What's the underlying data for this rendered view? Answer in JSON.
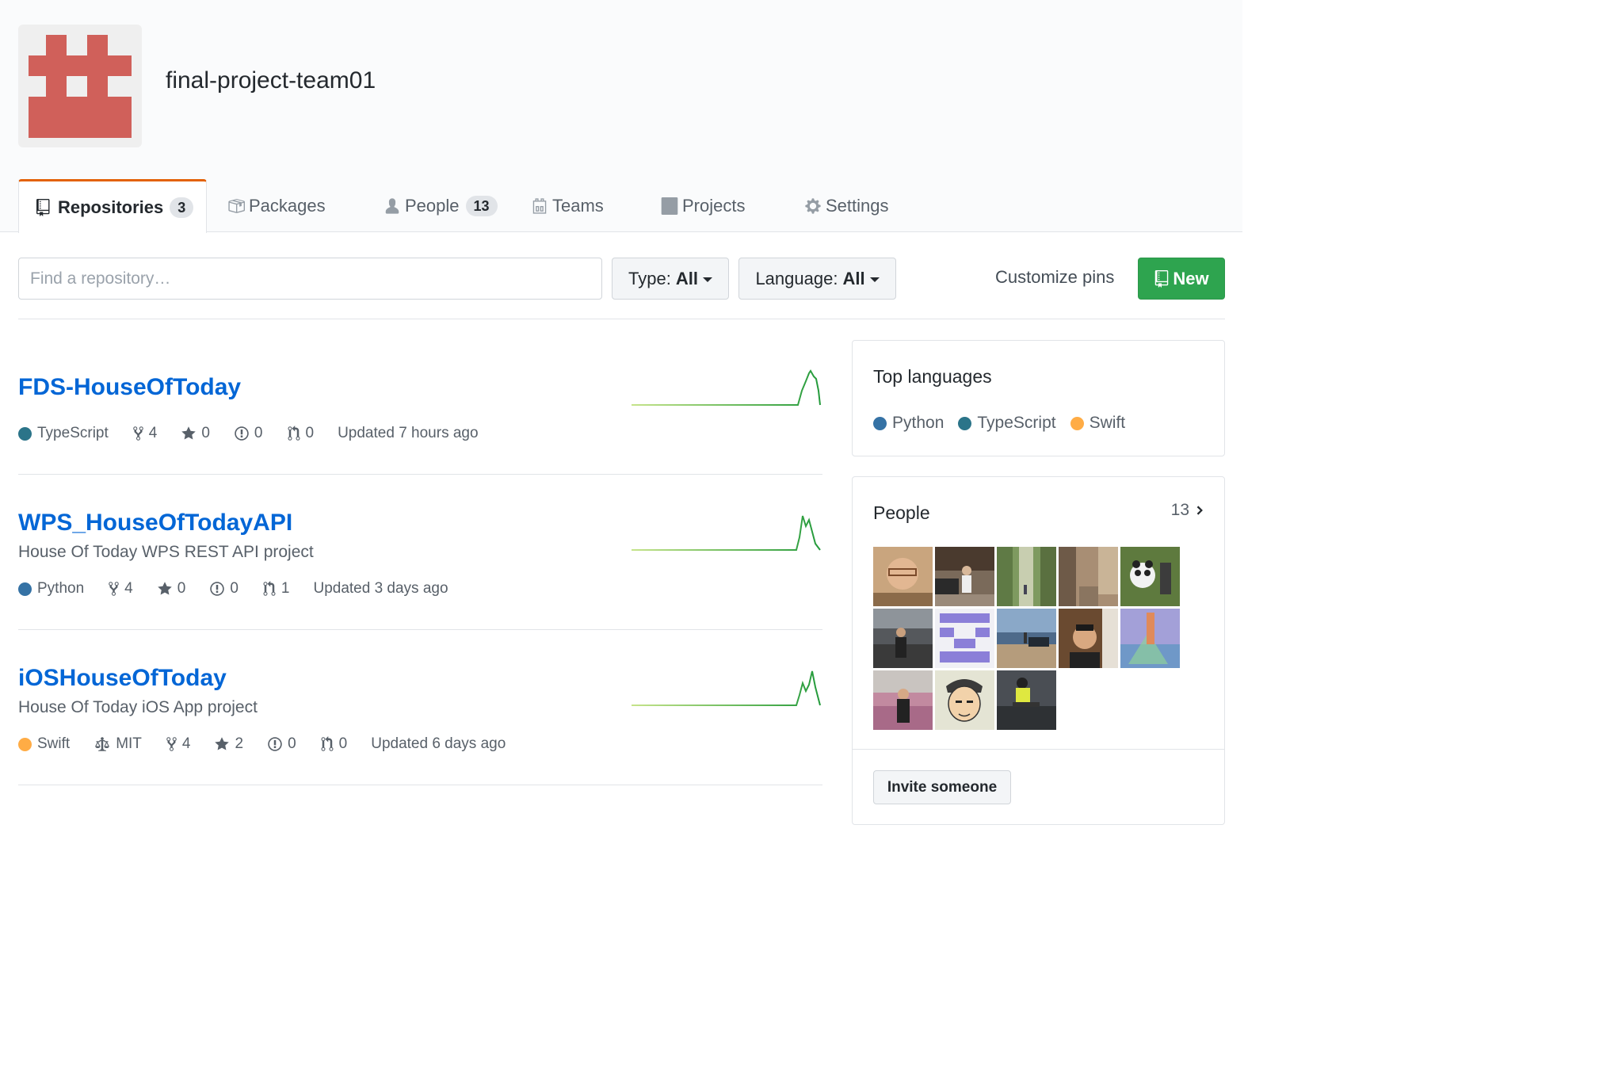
{
  "org": {
    "name": "final-project-team01"
  },
  "tabs": [
    {
      "label": "Repositories",
      "count": "3",
      "icon": "repo-icon"
    },
    {
      "label": "Packages",
      "icon": "package-icon"
    },
    {
      "label": "People",
      "count": "13",
      "icon": "person-icon"
    },
    {
      "label": "Teams",
      "icon": "team-icon"
    },
    {
      "label": "Projects",
      "icon": "project-icon"
    },
    {
      "label": "Settings",
      "icon": "gear-icon"
    }
  ],
  "filters": {
    "search_placeholder": "Find a repository…",
    "type_label": "Type:",
    "type_value": "All",
    "language_label": "Language:",
    "language_value": "All",
    "customize_pins": "Customize pins",
    "new_button": "New"
  },
  "repos": [
    {
      "name": "FDS-HouseOfToday",
      "description": "",
      "language": "TypeScript",
      "language_color": "#2b7489",
      "license": "",
      "forks": "4",
      "stars": "0",
      "issues": "0",
      "pulls": "0",
      "updated": "Updated 7 hours ago"
    },
    {
      "name": "WPS_HouseOfTodayAPI",
      "description": "House Of Today WPS REST API project",
      "language": "Python",
      "language_color": "#3572A5",
      "license": "",
      "forks": "4",
      "stars": "0",
      "issues": "0",
      "pulls": "1",
      "updated": "Updated 3 days ago"
    },
    {
      "name": "iOSHouseOfToday",
      "description": "House Of Today iOS App project",
      "language": "Swift",
      "language_color": "#ffac45",
      "license": "MIT",
      "forks": "4",
      "stars": "2",
      "issues": "0",
      "pulls": "0",
      "updated": "Updated 6 days ago"
    }
  ],
  "top_languages": {
    "title": "Top languages",
    "items": [
      {
        "name": "Python",
        "color": "#3572A5"
      },
      {
        "name": "TypeScript",
        "color": "#2b7489"
      },
      {
        "name": "Swift",
        "color": "#ffac45"
      }
    ]
  },
  "people": {
    "title": "People",
    "count": "13",
    "invite_label": "Invite someone"
  }
}
